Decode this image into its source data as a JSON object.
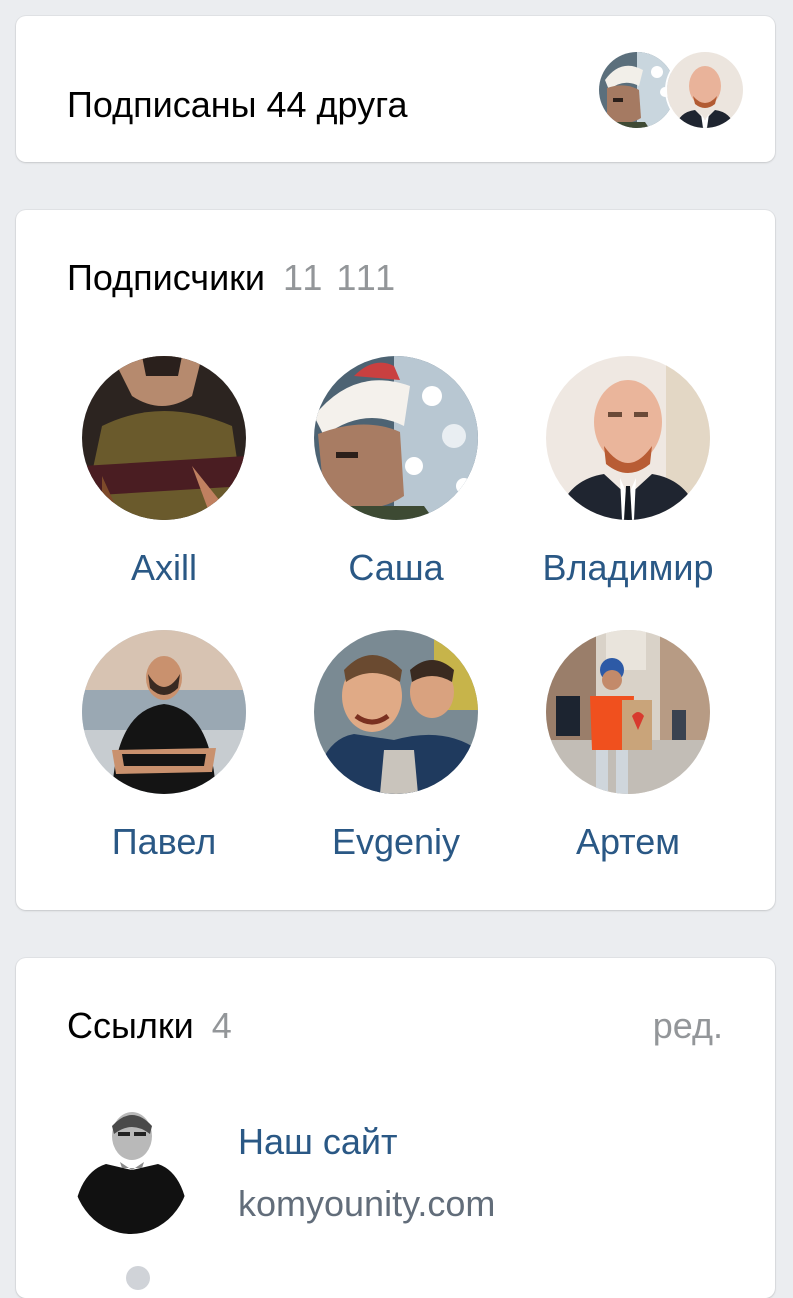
{
  "friends_subscribed": {
    "text": "Подписаны 44 друга",
    "avatars": [
      "friend-avatar-santa-hat",
      "friend-avatar-bald-man"
    ]
  },
  "followers": {
    "title": "Подписчики",
    "count": "11 111",
    "items": [
      {
        "name": "Axill",
        "avatar": "avatar-guitar-player"
      },
      {
        "name": "Саша",
        "avatar": "avatar-santa-hat"
      },
      {
        "name": "Владимир",
        "avatar": "avatar-bald-man-suit"
      },
      {
        "name": "Павел",
        "avatar": "avatar-man-black-tshirt"
      },
      {
        "name": "Evgeniy",
        "avatar": "avatar-two-people-selfie"
      },
      {
        "name": "Артем",
        "avatar": "avatar-street-orange-shirt"
      }
    ]
  },
  "links": {
    "title": "Ссылки",
    "count": "4",
    "edit_label": "ред.",
    "items": [
      {
        "title": "Наш сайт",
        "url": "komyounity.com",
        "avatar": "avatar-man-black-white"
      }
    ]
  },
  "colors": {
    "background": "#ebedf0",
    "card": "#ffffff",
    "link_blue": "#2a5885",
    "muted_gray": "#939699"
  }
}
